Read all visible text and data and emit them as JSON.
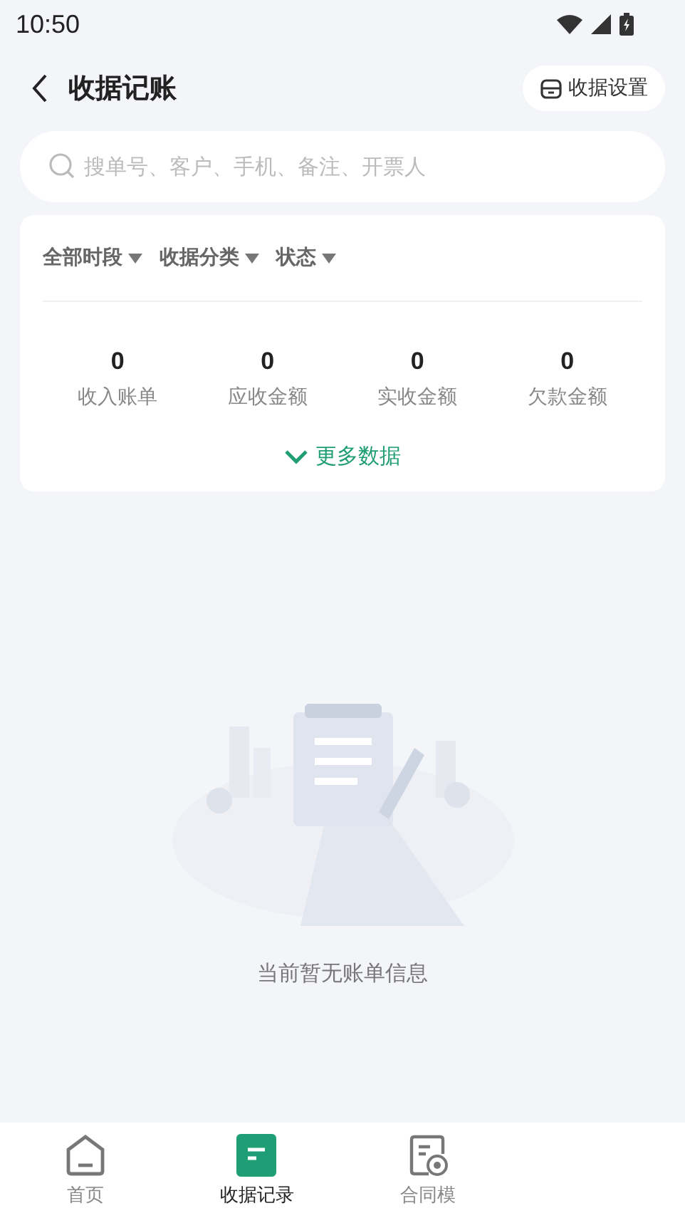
{
  "status_bar": {
    "time": "10:50"
  },
  "header": {
    "title": "收据记账",
    "settings_button": "收据设置"
  },
  "search": {
    "placeholder": "搜单号、客户、手机、备注、开票人"
  },
  "filters": [
    {
      "label": "全部时段"
    },
    {
      "label": "收据分类"
    },
    {
      "label": "状态"
    }
  ],
  "stats": [
    {
      "value": "0",
      "label": "收入账单"
    },
    {
      "value": "0",
      "label": "应收金额"
    },
    {
      "value": "0",
      "label": "实收金额"
    },
    {
      "value": "0",
      "label": "欠款金额"
    }
  ],
  "more_button": "更多数据",
  "empty_message": "当前暂无账单信息",
  "tabs": [
    {
      "label": "首页",
      "kind": "home",
      "selected": false
    },
    {
      "label": "收据记录",
      "kind": "receipt",
      "selected": true
    },
    {
      "label": "合同模",
      "kind": "contract",
      "selected": false
    }
  ]
}
